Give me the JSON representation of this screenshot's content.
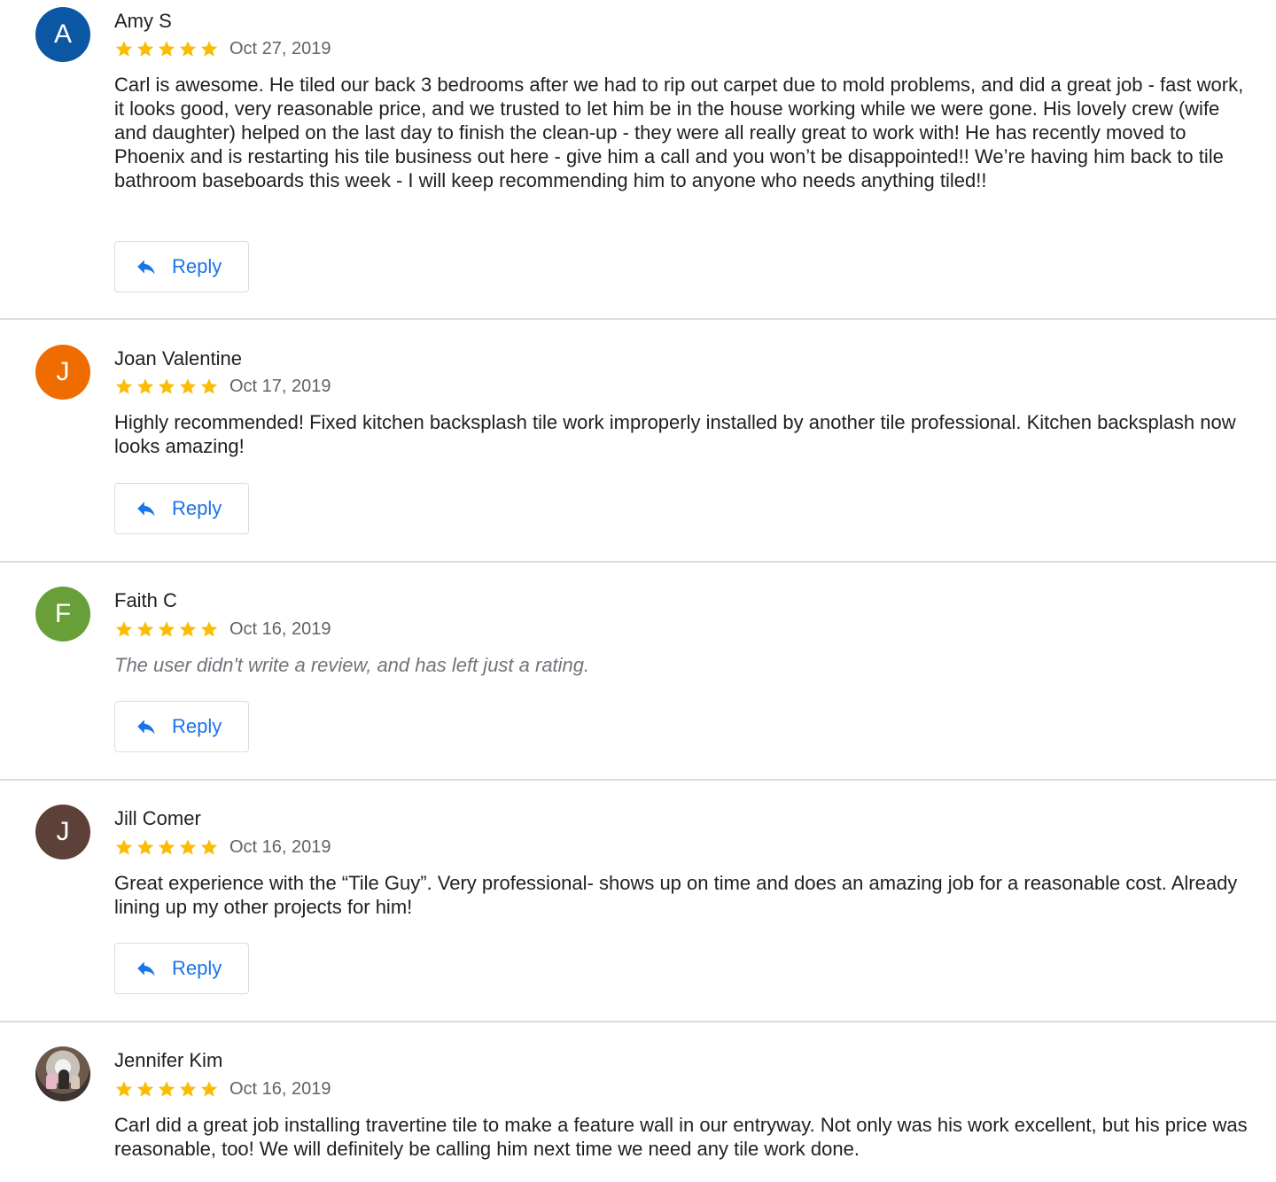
{
  "colors": {
    "star": "#fbbc04",
    "reply_text": "#1a73e8",
    "divider": "#dadce0"
  },
  "icons": {
    "star": "star-icon",
    "reply": "reply-arrow-icon"
  },
  "reviews": [
    {
      "avatar_letter": "A",
      "avatar_color": "#0b57a4",
      "name": "Amy S",
      "rating": 5,
      "date": "Oct 27, 2019",
      "text": "Carl is awesome. He tiled our back 3 bedrooms after we had to rip out carpet due to mold problems, and did a great job - fast work, it looks good, very reasonable price, and we trusted to let him be in the house working while we were gone. His lovely crew (wife and daughter) helped on the last day to finish the clean-up - they were all really great to work with! He has recently moved to Phoenix and is restarting his tile business out here - give him a call and you won’t be disappointed!! We’re having him back to tile bathroom baseboards this week - I will keep recommending him to anyone who needs anything tiled!!",
      "reply_label": "Reply"
    },
    {
      "avatar_letter": "J",
      "avatar_color": "#ef6c00",
      "name": "Joan Valentine",
      "rating": 5,
      "date": "Oct 17, 2019",
      "text": "Highly recommended! Fixed kitchen backsplash tile work improperly installed by another tile professional. Kitchen backsplash now looks amazing!",
      "reply_label": "Reply"
    },
    {
      "avatar_letter": "F",
      "avatar_color": "#689f38",
      "name": "Faith C",
      "rating": 5,
      "date": "Oct 16, 2019",
      "text": "The user didn't write a review, and has left just a rating.",
      "reply_label": "Reply"
    },
    {
      "avatar_letter": "J",
      "avatar_color": "#5d4037",
      "name": "Jill Comer",
      "rating": 5,
      "date": "Oct 16, 2019",
      "text": "Great experience with the “Tile Guy”. Very professional- shows up on time and does an amazing job for a reasonable cost. Already lining up my other projects for him!",
      "reply_label": "Reply"
    },
    {
      "avatar_letter": "",
      "avatar_color": "#8d7b6e",
      "name": "Jennifer Kim",
      "rating": 5,
      "date": "Oct 16, 2019",
      "text": "Carl did a great job installing travertine tile to make a feature wall in our entryway. Not only was his work excellent, but his price was reasonable, too! We will definitely be calling him next time we need any tile work done.",
      "reply_label": ""
    }
  ]
}
